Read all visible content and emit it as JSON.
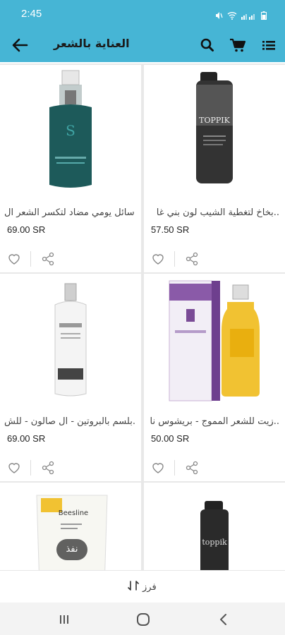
{
  "status_bar": {
    "time": "2:45"
  },
  "header": {
    "title": "العناية بالشعر"
  },
  "products": [
    {
      "name": "بخاخ لتغطية الشيب لون بني غا..",
      "price": "57.50 SR"
    },
    {
      "name": "سائل يومي مضاد لتكسر الشعر ال..",
      "price": "69.00 SR"
    },
    {
      "name": "زيت للشعر المموج - بريشوس نا..",
      "price": "50.00 SR"
    },
    {
      "name": "بلسم بالبروتين - ال صالون - للش..",
      "price": "69.00 SR"
    },
    {
      "name": "",
      "price": ""
    },
    {
      "name": "",
      "price": ""
    }
  ],
  "product_images": {
    "p3_brand": "Beesline",
    "p6_brand": "toppik",
    "p1_brand": "TOPPIK"
  },
  "toast": {
    "text": "نفذ"
  },
  "bottom_bar": {
    "sort_label": "فرز"
  },
  "colors": {
    "primary": "#46b5d5",
    "background": "#e8e8e8"
  }
}
